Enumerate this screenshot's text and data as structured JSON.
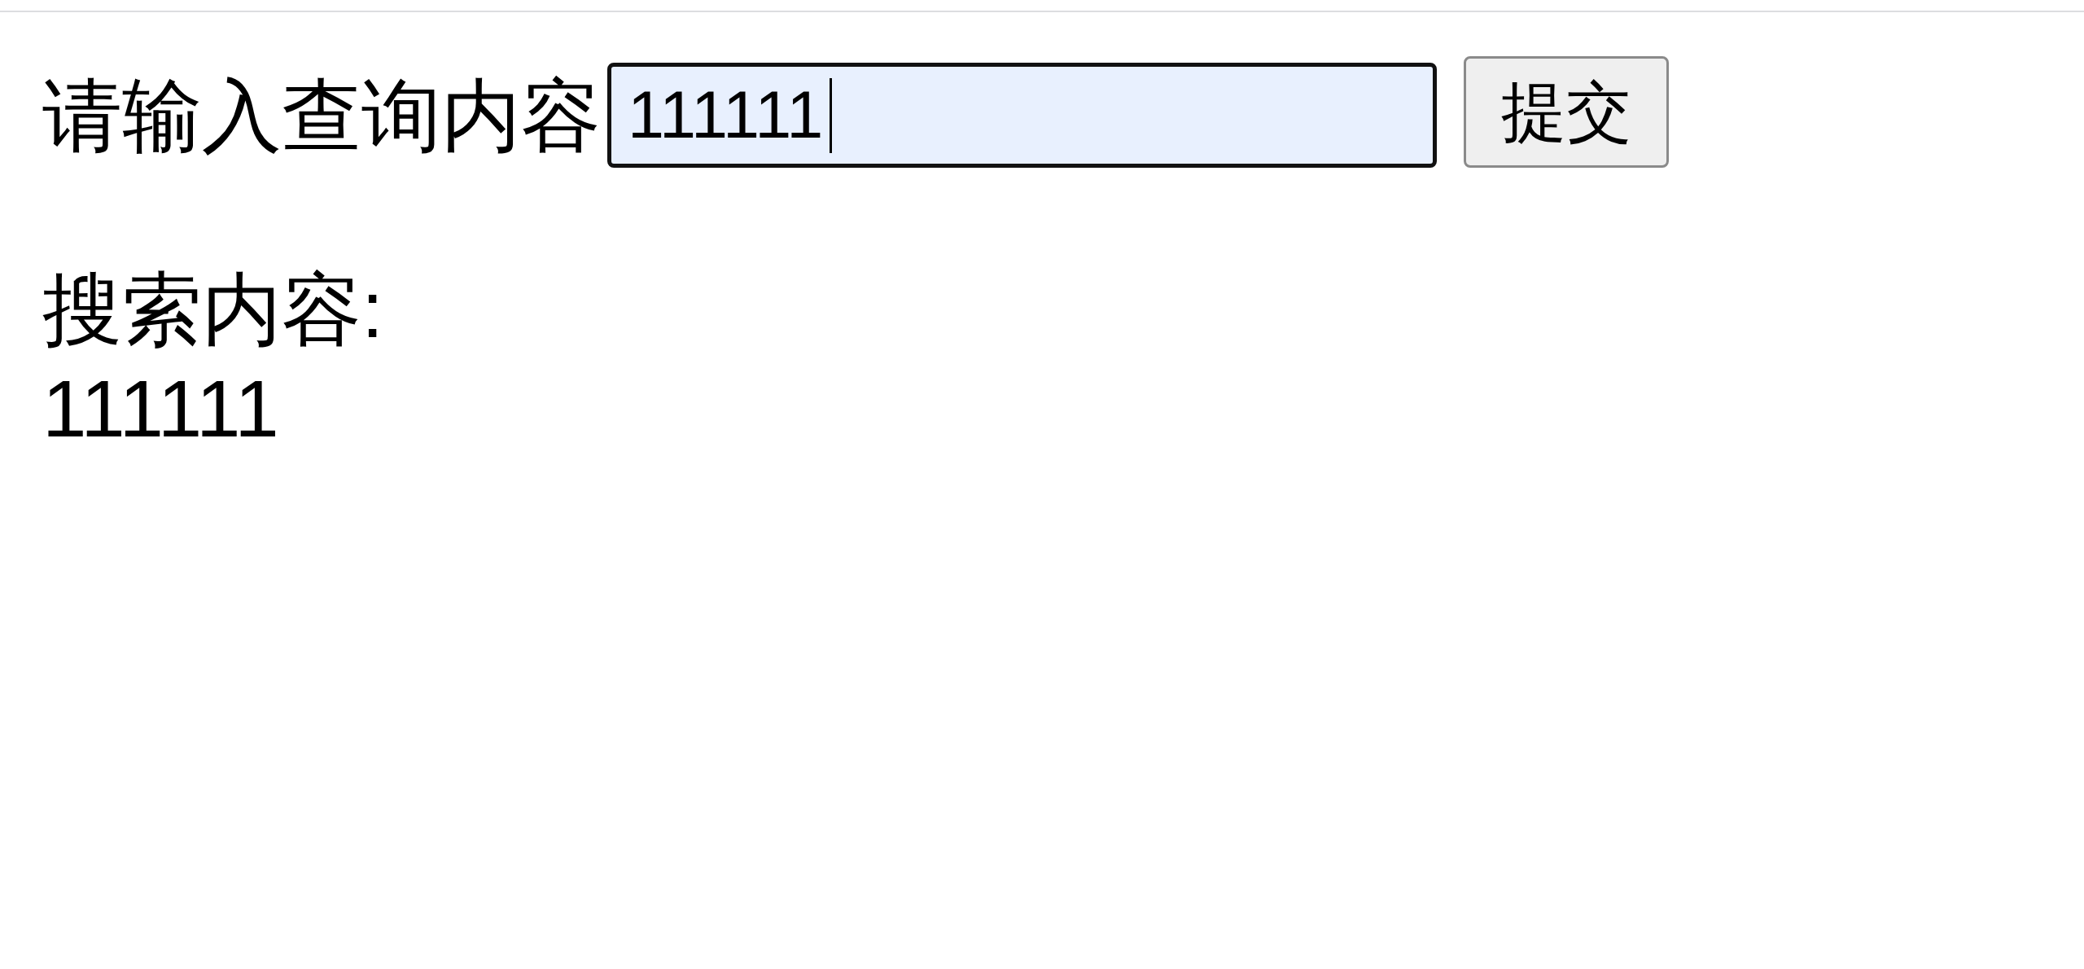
{
  "form": {
    "label": "请输入查询内容",
    "input": {
      "value": "111111",
      "focused": true
    },
    "submit_button": "提交"
  },
  "result": {
    "heading": "搜索内容:",
    "value": "111111"
  }
}
